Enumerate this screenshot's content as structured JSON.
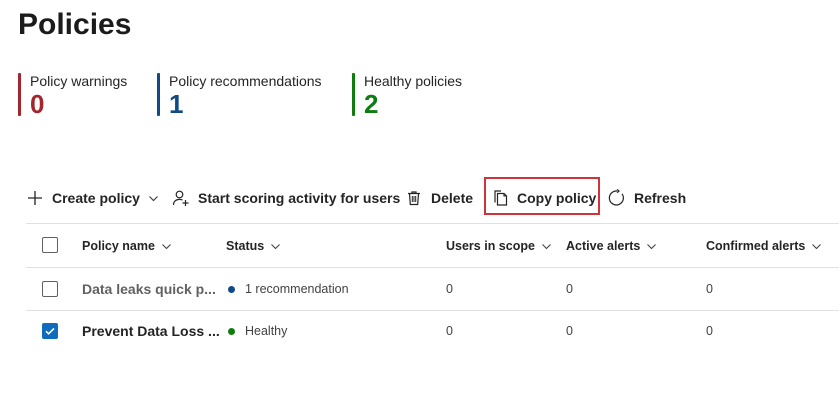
{
  "page": {
    "title": "Policies"
  },
  "stats": [
    {
      "label": "Policy warnings",
      "value": "0",
      "color": "#a4262c"
    },
    {
      "label": "Policy recommendations",
      "value": "1",
      "color": "#0f4a85"
    },
    {
      "label": "Healthy policies",
      "value": "2",
      "color": "#107c10"
    }
  ],
  "toolbar": {
    "create_label": "Create policy",
    "scoring_label": "Start scoring activity for users",
    "delete_label": "Delete",
    "copy_label": "Copy policy",
    "refresh_label": "Refresh",
    "highlight_color": "#d13438"
  },
  "table": {
    "columns": [
      "Policy name",
      "Status",
      "Users in scope",
      "Active alerts",
      "Confirmed alerts"
    ],
    "rows": [
      {
        "name": "Data leaks quick p...",
        "status": "1 recommendation",
        "status_color": "#0f4a85",
        "users": "0",
        "active": "0",
        "confirmed": "0",
        "selected": false
      },
      {
        "name": "Prevent Data Loss ...",
        "status": "Healthy",
        "status_color": "#107c10",
        "users": "0",
        "active": "0",
        "confirmed": "0",
        "selected": true
      }
    ]
  }
}
